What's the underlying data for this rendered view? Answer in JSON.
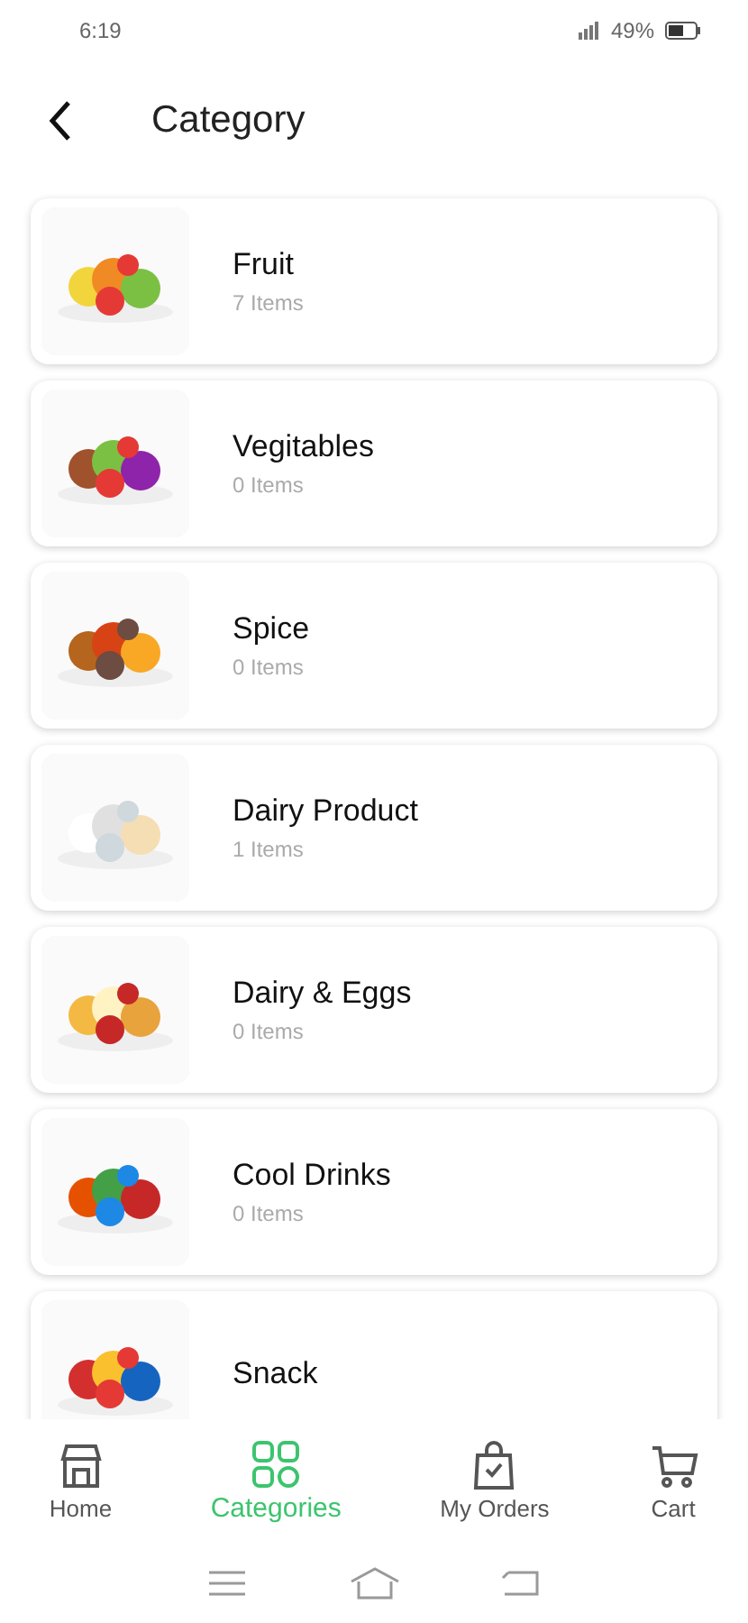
{
  "status_bar": {
    "time": "6:19",
    "battery": "49%"
  },
  "header": {
    "title": "Category"
  },
  "categories": [
    {
      "name": "Fruit",
      "count": "7 Items"
    },
    {
      "name": "Vegitables",
      "count": "0 Items"
    },
    {
      "name": "Spice",
      "count": "0 Items"
    },
    {
      "name": "Dairy Product",
      "count": "1 Items"
    },
    {
      "name": "Dairy & Eggs",
      "count": "0 Items"
    },
    {
      "name": "Cool Drinks",
      "count": "0 Items"
    },
    {
      "name": "Snack"
    }
  ],
  "bottom_nav": [
    {
      "label": "Home",
      "kind": "home",
      "selected": false
    },
    {
      "label": "Categories",
      "kind": "grid",
      "selected": true
    },
    {
      "label": "My Orders",
      "kind": "bag",
      "selected": false
    },
    {
      "label": "Cart",
      "kind": "cart",
      "selected": false
    }
  ]
}
